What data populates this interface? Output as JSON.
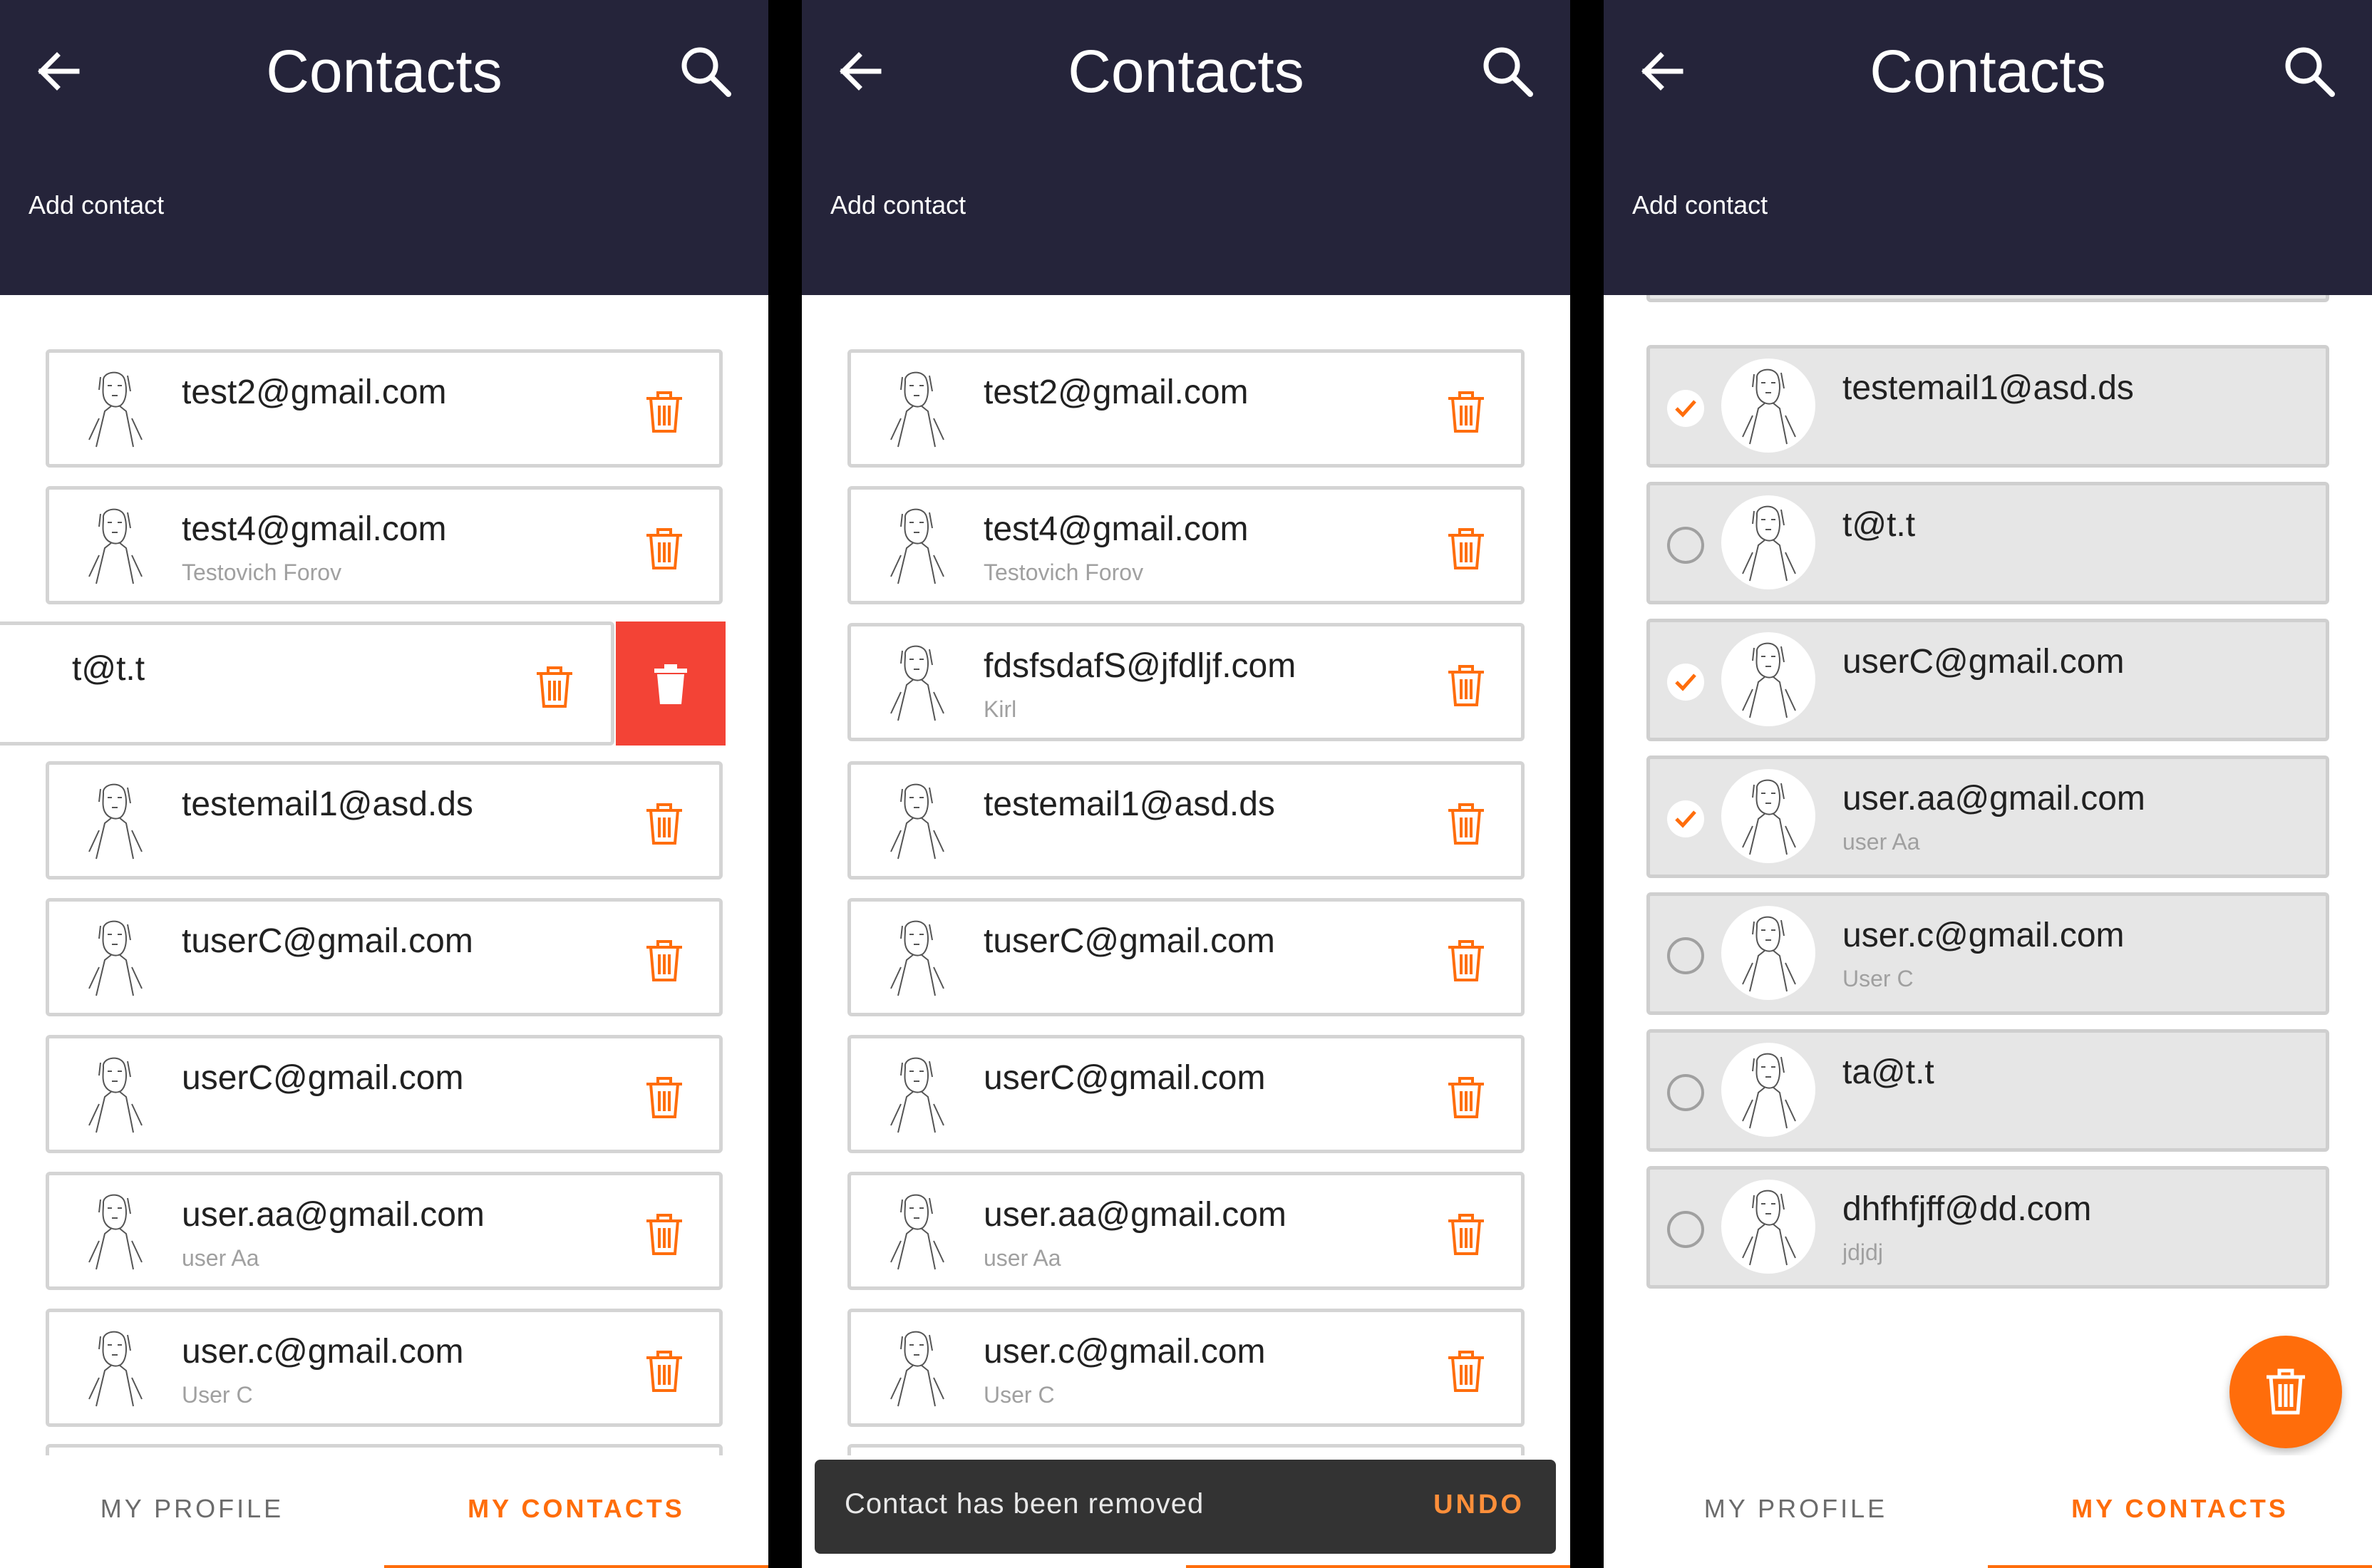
{
  "colors": {
    "header_bg": "#25243a",
    "accent": "#ff6d0b",
    "delete_red": "#f34336",
    "snackbar_bg": "#333333",
    "selected_card_bg": "#e6e6e6"
  },
  "header": {
    "title": "Contacts",
    "add_contact": "Add contact",
    "back_icon": "arrow-left-icon",
    "search_icon": "search-icon"
  },
  "tabs": {
    "profile": "MY PROFILE",
    "contacts": "MY CONTACTS",
    "active": "contacts"
  },
  "panel1": {
    "contacts": [
      {
        "email": "test2@gmail.com",
        "name": ""
      },
      {
        "email": "test4@gmail.com",
        "name": "Testovich Forov"
      },
      {
        "email": "t@t.t",
        "name": "",
        "swiped": true
      },
      {
        "email": "testemail1@asd.ds",
        "name": ""
      },
      {
        "email": "tuserC@gmail.com",
        "name": ""
      },
      {
        "email": "userC@gmail.com",
        "name": ""
      },
      {
        "email": "user.aa@gmail.com",
        "name": "user Aa"
      },
      {
        "email": "user.c@gmail.com",
        "name": "User C"
      }
    ]
  },
  "panel2": {
    "contacts": [
      {
        "email": "test2@gmail.com",
        "name": ""
      },
      {
        "email": "test4@gmail.com",
        "name": "Testovich Forov"
      },
      {
        "email": "fdsfsdafS@jfdljf.com",
        "name": "Kirl"
      },
      {
        "email": "testemail1@asd.ds",
        "name": ""
      },
      {
        "email": "tuserC@gmail.com",
        "name": ""
      },
      {
        "email": "userC@gmail.com",
        "name": ""
      },
      {
        "email": "user.aa@gmail.com",
        "name": "user Aa"
      },
      {
        "email": "user.c@gmail.com",
        "name": "User C"
      }
    ],
    "snackbar": {
      "message": "Contact has been removed",
      "action": "UNDO"
    }
  },
  "panel3": {
    "contacts": [
      {
        "email": "testemail1@asd.ds",
        "name": "",
        "selected": true
      },
      {
        "email": "t@t.t",
        "name": "",
        "selected": false
      },
      {
        "email": "userC@gmail.com",
        "name": "",
        "selected": true
      },
      {
        "email": "user.aa@gmail.com",
        "name": "user Aa",
        "selected": true
      },
      {
        "email": "user.c@gmail.com",
        "name": "User C",
        "selected": false
      },
      {
        "email": "ta@t.t",
        "name": "",
        "selected": false
      },
      {
        "email": "dhfhfjff@dd.com",
        "name": "jdjdj",
        "selected": false
      }
    ],
    "fab_icon": "trash-icon"
  }
}
